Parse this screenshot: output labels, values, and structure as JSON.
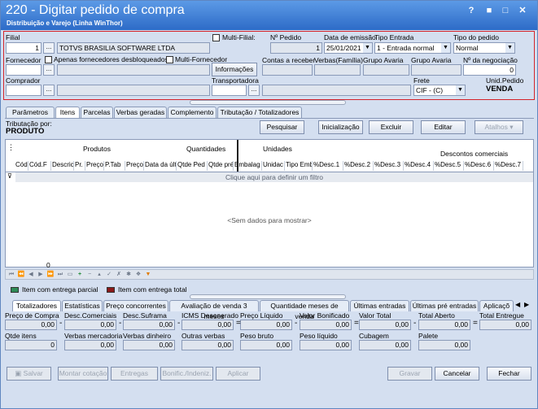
{
  "window": {
    "title": "220 - Digitar pedido de compra",
    "subtitle": "Distribuição e Varejo (Linha WinThor)",
    "controls": [
      "?",
      "■",
      "□",
      "✕"
    ]
  },
  "header": {
    "filial_label": "Filial",
    "filial_value": "1",
    "filial_name": "TOTVS BRASILIA SOFTWARE LTDA",
    "multi_filial_label": "Multi-Filial:",
    "num_pedido_label": "Nº Pedido",
    "num_pedido_value": "1",
    "data_emissao_label": "Data de emissão",
    "data_emissao_value": "25/01/2021",
    "tipo_entrada_label": "Tipo Entrada",
    "tipo_entrada_value": "1 - Entrada normal",
    "tipo_pedido_label": "Tipo do pedido",
    "tipo_pedido_value": "Normal",
    "fornecedor_label": "Fornecedor",
    "apenas_desbloqueados_label": "Apenas fornecedores desbloqueados",
    "multi_fornecedor_label": "Multi-Fornecedor",
    "informacoes_label": "Informações",
    "contas_receber_label": "Contas a receber",
    "verbas_familia_label": "Verbas(Família)",
    "grupo_avaria1_label": "Grupo Avaria",
    "grupo_avaria2_label": "Grupo Avaria",
    "num_negociacao_label": "Nº da negociação",
    "num_negociacao_value": "0",
    "comprador_label": "Comprador",
    "transportadora_label": "Transportadora",
    "frete_label": "Frete",
    "frete_value": "CIF - (C)",
    "unid_pedido_label": "Unid.Pedido",
    "unid_pedido_value": "VENDA",
    "browse": "..."
  },
  "tabs": [
    "Parâmetros",
    "Itens",
    "Parcelas",
    "Verbas geradas",
    "Complemento",
    "Tributação / Totalizadores"
  ],
  "items": {
    "tributacao_label": "Tributação por:",
    "tributacao_value": "PRODUTO",
    "pesquisar": "Pesquisar",
    "inicializacao": "Inicialização",
    "excluir": "Excluir",
    "editar": "Editar",
    "atalhos": "Atalhos",
    "groups": {
      "produtos": "Produtos",
      "quantidades": "Quantidades",
      "unidades": "Unidades",
      "descontos": "Descontos comerciais"
    },
    "columns": [
      "Cód",
      "Cód.F",
      "Descric",
      "Pr.",
      "Preço",
      "P.Tab",
      "Preço",
      "Data da últ",
      "Qtde Ped",
      "Qtde pré",
      "Embalag",
      "Unidac",
      "Tipo Emb",
      "%Desc.1",
      "%Desc.2",
      "%Desc.3",
      "%Desc.4",
      "%Desc.5",
      "%Desc.6",
      "%Desc.7"
    ],
    "filter_hint": "Clique aqui para definir um filtro",
    "empty": "<Sem dados para mostrar>",
    "count": "0",
    "legend1": "Item com entrega parcial",
    "legend2": "Item com entrega total",
    "legend1_color": "#2e8b57",
    "legend2_color": "#8b1a1a"
  },
  "bottom_tabs": [
    "Totalizadores",
    "Estatísticas",
    "Preço concorrentes",
    "Avaliação de venda 3 meses",
    "Quantidade meses de venda",
    "Últimas entradas",
    "Últimas pré entradas",
    "Aplicaçõ"
  ],
  "totals": {
    "row1": [
      {
        "label": "Preço de Compra",
        "value": "0,00"
      },
      {
        "label": "Desc.Comerciais",
        "value": "0,00"
      },
      {
        "label": "Desc.Suframa",
        "value": "0,00"
      },
      {
        "label": "ICMS Desonerado",
        "value": "0,00"
      },
      {
        "label": "Preço Líquido",
        "value": "0,00"
      },
      {
        "label": "Valor Bonificado",
        "value": "0,00"
      },
      {
        "label": "Valor Total",
        "value": "0,00"
      },
      {
        "label": "Total Aberto",
        "value": "0,00"
      },
      {
        "label": "Total Entregue",
        "value": "0,00"
      }
    ],
    "ops": [
      "-",
      "-",
      "-",
      "=",
      "-",
      "=",
      "-",
      "="
    ],
    "row2": [
      {
        "label": "Qtde itens",
        "value": "0"
      },
      {
        "label": "Verbas mercadoria",
        "value": "0,00"
      },
      {
        "label": "Verbas dinheiro",
        "value": "0,00"
      },
      {
        "label": "Outras verbas",
        "value": "0,00"
      },
      {
        "label": "Peso bruto",
        "value": "0,00"
      },
      {
        "label": "Peso líquido",
        "value": "0,00"
      },
      {
        "label": "Cubagem",
        "value": "0,00"
      },
      {
        "label": "Palete",
        "value": "0,00"
      }
    ]
  },
  "footer": {
    "salvar": "Salvar",
    "montar_cotacao": "Montar cotação",
    "entregas": "Entregas",
    "bonific": "Bonific./Indeniz.",
    "aplicar": "Aplicar",
    "gravar": "Gravar",
    "cancelar": "Cancelar",
    "fechar": "Fechar"
  }
}
